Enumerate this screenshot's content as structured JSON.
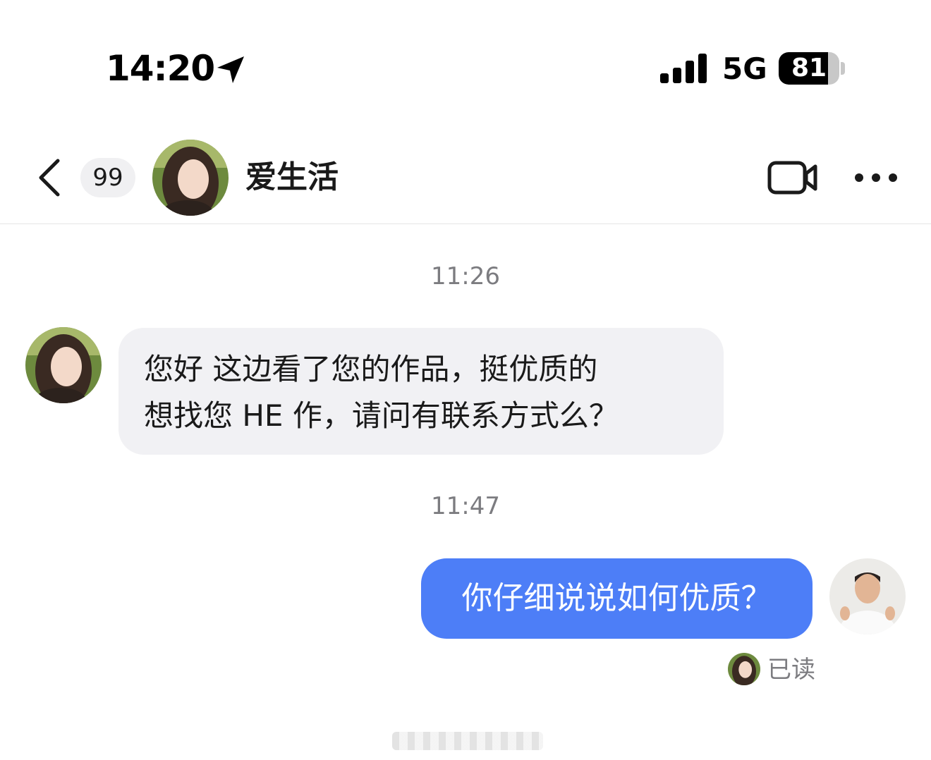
{
  "status_bar": {
    "time": "14:20",
    "location_icon": "location-arrow-icon",
    "signal_icon": "cellular-signal-icon",
    "network": "5G",
    "battery_level": "81",
    "battery_fraction": 0.81
  },
  "header": {
    "back_icon": "chevron-left-icon",
    "unread_count": "99",
    "contact_name": "爱生活",
    "video_call_icon": "video-camera-icon",
    "more_icon": "more-dots-icon"
  },
  "messages": [
    {
      "timestamp": "11:26",
      "direction": "received",
      "lines": [
        "您好 这边看了您的作品，挺优质的",
        "想找您 HE 作，请问有联系方式么？"
      ]
    },
    {
      "timestamp": "11:47",
      "direction": "sent",
      "text": "你仔细说说如何优质？",
      "read_status": "已读"
    }
  ],
  "colors": {
    "sent_bubble": "#4d7ef7",
    "received_bubble": "#f1f1f4",
    "timestamp_text": "#7c7c80"
  }
}
